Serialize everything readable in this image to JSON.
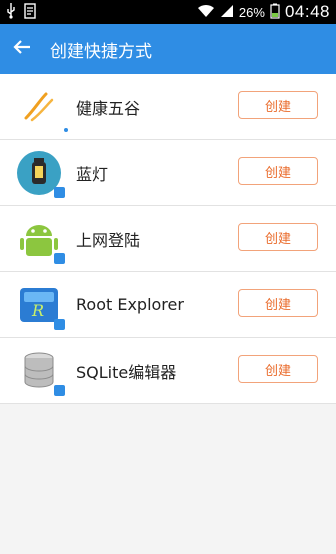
{
  "status_bar": {
    "battery": "26%",
    "time": "04:48"
  },
  "app_bar": {
    "title": "创建快捷方式"
  },
  "apps": [
    {
      "name": "健康五谷",
      "button": "创建",
      "icon": "grain-icon"
    },
    {
      "name": "蓝灯",
      "button": "创建",
      "icon": "lantern-icon"
    },
    {
      "name": "上网登陆",
      "button": "创建",
      "icon": "android-icon"
    },
    {
      "name": "Root Explorer",
      "button": "创建",
      "icon": "root-explorer-icon"
    },
    {
      "name": "SQLite编辑器",
      "button": "创建",
      "icon": "database-icon"
    }
  ],
  "colors": {
    "app_bar": "#2f8de4",
    "button_text": "#ea6c2c",
    "button_border": "#f2a37a"
  }
}
